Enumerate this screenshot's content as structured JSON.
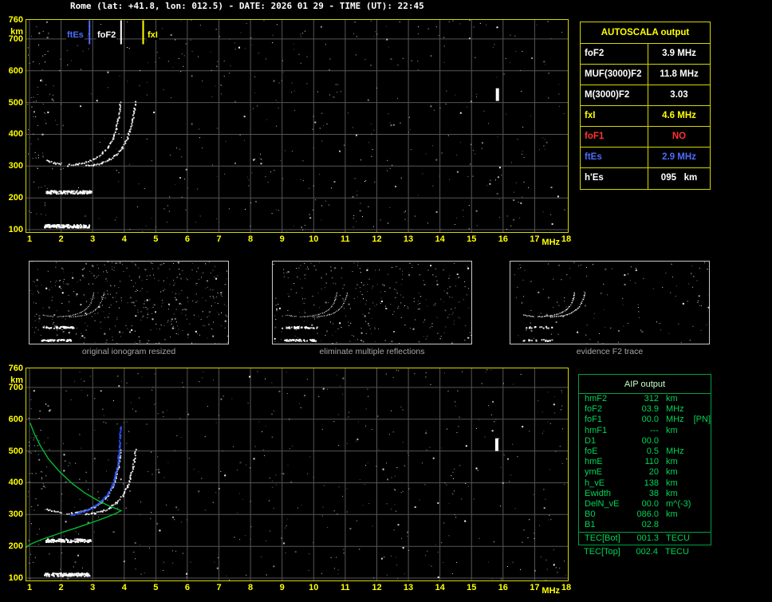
{
  "header": {
    "title": "Rome (lat: +41.8, lon: 012.5) - DATE: 2026 01 29 - TIME (UT): 22:45"
  },
  "colors": {
    "background": "#000000",
    "plot_border_yellow": "#d6d600",
    "axis_yellow": "#ffff00",
    "grid_gray": "#555555",
    "trace_white": "#ffffff",
    "restored_trace_blue": "#2e55ff",
    "profile_green": "#00bb33",
    "aip_green": "#00d455",
    "alert_red": "#ff3333",
    "ftEs_blue": "#4b6cff",
    "caption_gray": "#a8a8a8"
  },
  "legend": {
    "ftEs": {
      "label": "ftEs",
      "freq": 2.9
    },
    "foF2": {
      "label": "foF2",
      "freq": 3.9
    },
    "fxI": {
      "label": "fxI",
      "freq": 4.6
    }
  },
  "autoscala_table": {
    "title": "AUTOSCALA output",
    "rows": [
      {
        "param": "foF2",
        "value": "3.9 MHz",
        "color": "white"
      },
      {
        "param": "MUF(3000)F2",
        "value": "11.8 MHz",
        "color": "white"
      },
      {
        "param": "M(3000)F2",
        "value": "3.03",
        "color": "white"
      },
      {
        "param": "fxI",
        "value": "4.6 MHz",
        "color": "yellow"
      },
      {
        "param": "foF1",
        "value": "NO",
        "color": "red"
      },
      {
        "param": "ftEs",
        "value": "2.9 MHz",
        "color": "blue"
      },
      {
        "param": "h'Es",
        "value": "095   km",
        "color": "white"
      }
    ]
  },
  "aip_table": {
    "title": "AIP output",
    "rows": [
      {
        "param": "hmF2",
        "value": "312",
        "unit": "km"
      },
      {
        "param": "foF2",
        "value": "03.9",
        "unit": "MHz"
      },
      {
        "param": "foF1",
        "value": "00.0",
        "unit": "MHz",
        "extra": "[PN]"
      },
      {
        "param": "hmF1",
        "value": "---",
        "unit": "km"
      },
      {
        "param": "D1",
        "value": "00.0",
        "unit": ""
      },
      {
        "param": "foE",
        "value": "0.5",
        "unit": "MHz"
      },
      {
        "param": "hmE",
        "value": "110",
        "unit": "km"
      },
      {
        "param": "ymE",
        "value": "20",
        "unit": "km"
      },
      {
        "param": "h_vE",
        "value": "138",
        "unit": "km"
      },
      {
        "param": "Ewidth",
        "value": "38",
        "unit": "km"
      },
      {
        "param": "DelN_vE",
        "value": "00.0",
        "unit": "m^(-3)"
      },
      {
        "param": "B0",
        "value": "086.0",
        "unit": "km"
      },
      {
        "param": "B1",
        "value": "02.8",
        "unit": ""
      }
    ],
    "tec_rows": [
      {
        "param": "TEC[Bot]",
        "value": "001.3",
        "unit": "TECU"
      },
      {
        "param": "TEC[Top]",
        "value": "002.4",
        "unit": "TECU"
      }
    ]
  },
  "thumbnails": [
    {
      "caption": "original ionogram resized",
      "noise": {
        "seed": 91,
        "count": 430
      }
    },
    {
      "caption": "eliminate multiple reflections",
      "noise": {
        "seed": 77,
        "count": 320
      }
    },
    {
      "caption": "evidence F2 trace",
      "noise": {
        "seed": 55,
        "count": 130
      }
    }
  ],
  "chart_data": [
    {
      "id": "top_ionogram",
      "type": "scatter",
      "xlabel": "MHz",
      "ylabel": "km",
      "xlim": [
        1,
        18
      ],
      "ylim": [
        100,
        760
      ],
      "grid": true,
      "x_ticks": [
        "1",
        "2",
        "3",
        "4",
        "5",
        "6",
        "7",
        "8",
        "9",
        "10",
        "11",
        "12",
        "13",
        "14",
        "15",
        "16",
        "17",
        "18"
      ],
      "y_ticks": [
        {
          "label": "760",
          "km": 760
        },
        {
          "label": "km",
          "km": 722
        },
        {
          "label": "700",
          "km": 700
        },
        {
          "label": "600",
          "km": 600
        },
        {
          "label": "500",
          "km": 500
        },
        {
          "label": "400",
          "km": 400
        },
        {
          "label": "300",
          "km": 300
        },
        {
          "label": "200",
          "km": 200
        },
        {
          "label": "100",
          "km": 100
        }
      ],
      "legend_markers": [
        {
          "label": "ftEs",
          "freq": 2.9,
          "color": "#4b6cff"
        },
        {
          "label": "foF2",
          "freq": 3.9,
          "color": "#ffffff"
        },
        {
          "label": "fxI",
          "freq": 4.6,
          "color": "#ffff00"
        }
      ],
      "white_traces": [
        [
          [
            2.2,
            302
          ],
          [
            2.5,
            306
          ],
          [
            2.8,
            312
          ],
          [
            3.05,
            322
          ],
          [
            3.3,
            338
          ],
          [
            3.5,
            360
          ],
          [
            3.65,
            388
          ],
          [
            3.75,
            418
          ],
          [
            3.82,
            450
          ],
          [
            3.86,
            478
          ],
          [
            3.88,
            502
          ]
        ],
        [
          [
            2.78,
            300
          ],
          [
            3.05,
            304
          ],
          [
            3.3,
            310
          ],
          [
            3.55,
            320
          ],
          [
            3.75,
            336
          ],
          [
            3.95,
            358
          ],
          [
            4.1,
            386
          ],
          [
            4.2,
            416
          ],
          [
            4.28,
            448
          ],
          [
            4.33,
            478
          ],
          [
            4.36,
            502
          ]
        ],
        [
          [
            1.55,
            316
          ],
          [
            1.78,
            310
          ],
          [
            2.0,
            305
          ]
        ]
      ],
      "es_bands": [
        {
          "km": 113,
          "f1": 1.45,
          "f2": 2.9,
          "n": 150
        },
        {
          "km": 220,
          "f1": 1.5,
          "f2": 2.95,
          "n": 130
        }
      ],
      "bright_bars": [
        {
          "f": 15.82,
          "km1": 505,
          "km2": 545
        }
      ],
      "noise": {
        "seed": 13,
        "count": 500,
        "left_cluster": 45
      }
    },
    {
      "id": "bottom_ionogram",
      "type": "scatter",
      "xlabel": "MHz",
      "ylabel": "km",
      "xlim": [
        1,
        18
      ],
      "ylim": [
        100,
        760
      ],
      "grid": true,
      "x_ticks": [
        "1",
        "2",
        "3",
        "4",
        "5",
        "6",
        "7",
        "8",
        "9",
        "10",
        "11",
        "12",
        "13",
        "14",
        "15",
        "16",
        "17",
        "18"
      ],
      "y_ticks": [
        {
          "label": "760",
          "km": 760
        },
        {
          "label": "km",
          "km": 722
        },
        {
          "label": "700",
          "km": 700
        },
        {
          "label": "600",
          "km": 600
        },
        {
          "label": "500",
          "km": 500
        },
        {
          "label": "400",
          "km": 400
        },
        {
          "label": "300",
          "km": 300
        },
        {
          "label": "200",
          "km": 200
        },
        {
          "label": "100",
          "km": 100
        }
      ],
      "white_traces": [
        [
          [
            2.2,
            302
          ],
          [
            2.5,
            306
          ],
          [
            2.8,
            312
          ],
          [
            3.05,
            322
          ],
          [
            3.3,
            338
          ],
          [
            3.5,
            360
          ],
          [
            3.65,
            388
          ],
          [
            3.75,
            418
          ],
          [
            3.82,
            450
          ],
          [
            3.86,
            478
          ],
          [
            3.88,
            502
          ]
        ],
        [
          [
            2.78,
            300
          ],
          [
            3.05,
            304
          ],
          [
            3.3,
            310
          ],
          [
            3.55,
            320
          ],
          [
            3.75,
            336
          ],
          [
            3.95,
            358
          ],
          [
            4.1,
            386
          ],
          [
            4.2,
            416
          ],
          [
            4.28,
            448
          ],
          [
            4.33,
            478
          ],
          [
            4.36,
            502
          ]
        ],
        [
          [
            1.55,
            316
          ],
          [
            1.78,
            310
          ],
          [
            2.0,
            305
          ]
        ]
      ],
      "blue_trace": [
        [
          2.35,
          298
        ],
        [
          2.6,
          305
        ],
        [
          2.85,
          314
        ],
        [
          3.1,
          326
        ],
        [
          3.3,
          343
        ],
        [
          3.5,
          366
        ],
        [
          3.65,
          396
        ],
        [
          3.75,
          432
        ],
        [
          3.82,
          472
        ],
        [
          3.86,
          512
        ],
        [
          3.88,
          548
        ],
        [
          3.89,
          576
        ]
      ],
      "green_profile": [
        [
          1.02,
          588
        ],
        [
          1.15,
          555
        ],
        [
          1.35,
          515
        ],
        [
          1.6,
          475
        ],
        [
          1.95,
          435
        ],
        [
          2.35,
          398
        ],
        [
          2.75,
          368
        ],
        [
          3.15,
          345
        ],
        [
          3.5,
          328
        ],
        [
          3.75,
          318
        ],
        [
          3.88,
          313
        ],
        [
          3.9,
          312
        ],
        [
          3.7,
          302
        ],
        [
          3.45,
          292
        ],
        [
          3.15,
          281
        ],
        [
          2.8,
          269
        ],
        [
          2.45,
          257
        ],
        [
          2.1,
          246
        ],
        [
          1.75,
          234
        ],
        [
          1.4,
          222
        ],
        [
          1.1,
          210
        ],
        [
          0.95,
          202
        ],
        [
          0.9,
          196
        ]
      ],
      "es_bands": [
        {
          "km": 113,
          "f1": 1.45,
          "f2": 2.9,
          "n": 150
        },
        {
          "km": 220,
          "f1": 1.5,
          "f2": 2.95,
          "n": 130
        }
      ],
      "bright_bars": [
        {
          "f": 15.8,
          "km1": 500,
          "km2": 540
        }
      ],
      "noise": {
        "seed": 47,
        "count": 500,
        "left_cluster": 45
      }
    }
  ]
}
